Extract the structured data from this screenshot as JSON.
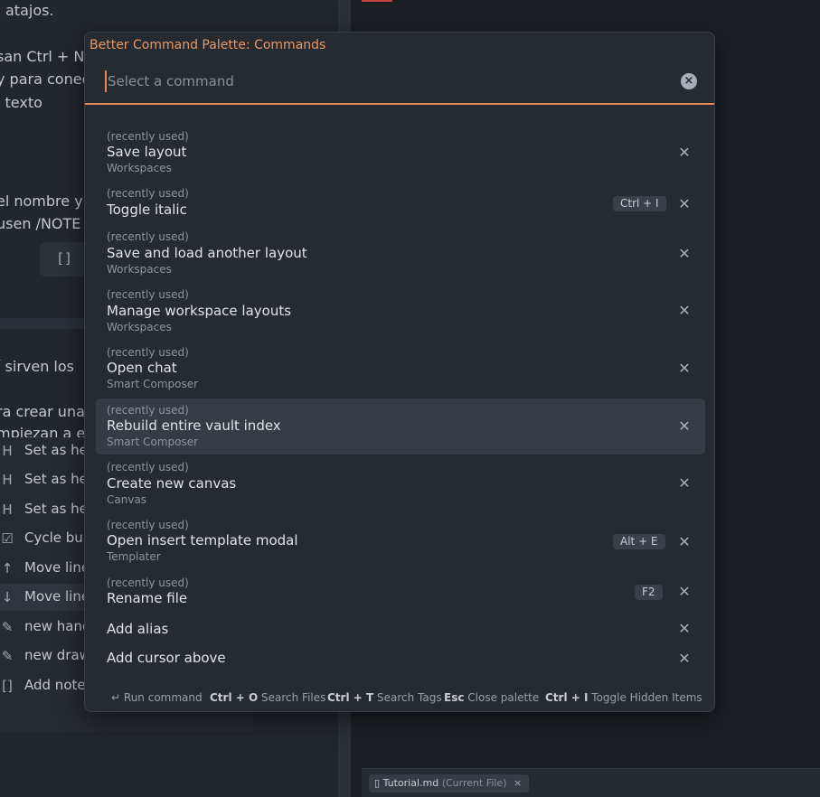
{
  "background": {
    "left_text": [
      "atajos.",
      "san Ctrl + N",
      "y para conec",
      "l texto",
      "el nombre y",
      "usen /NOTE",
      "í sirven los",
      "ra crear una",
      "mpiezan a es"
    ],
    "code_chip": "[]",
    "suggestions": [
      {
        "icon": "H",
        "label": "Set as he"
      },
      {
        "icon": "H",
        "label": "Set as he"
      },
      {
        "icon": "H",
        "label": "Set as he"
      },
      {
        "icon": "☑",
        "label": "Cycle bul"
      },
      {
        "icon": "↑",
        "label": "Move line"
      },
      {
        "icon": "↓",
        "label": "Move line"
      },
      {
        "icon": "✎",
        "label": "new hand"
      },
      {
        "icon": "✎",
        "label": "new draw"
      },
      {
        "icon": "[]",
        "label": "Add note"
      }
    ],
    "file_chip": {
      "name": "Tutorial.md",
      "suffix": "(Current File)",
      "close": "×"
    }
  },
  "palette": {
    "title": "Better Command Palette: Commands",
    "search_placeholder": "Select a command",
    "search_value": "",
    "clear_glyph": "×",
    "remove_glyph": "✕",
    "items": [
      {
        "note": "(recently used)",
        "name": "Save layout",
        "category": "Workspaces",
        "hotkey": ""
      },
      {
        "note": "(recently used)",
        "name": "Toggle italic",
        "category": "",
        "hotkey": "Ctrl + I"
      },
      {
        "note": "(recently used)",
        "name": "Save and load another layout",
        "category": "Workspaces",
        "hotkey": ""
      },
      {
        "note": "(recently used)",
        "name": "Manage workspace layouts",
        "category": "Workspaces",
        "hotkey": ""
      },
      {
        "note": "(recently used)",
        "name": "Open chat",
        "category": "Smart Composer",
        "hotkey": ""
      },
      {
        "note": "(recently used)",
        "name": "Rebuild entire vault index",
        "category": "Smart Composer",
        "hotkey": ""
      },
      {
        "note": "(recently used)",
        "name": "Create new canvas",
        "category": "Canvas",
        "hotkey": ""
      },
      {
        "note": "(recently used)",
        "name": "Open insert template modal",
        "category": "Templater",
        "hotkey": "Alt + E"
      },
      {
        "note": "(recently used)",
        "name": "Rename file",
        "category": "",
        "hotkey": "F2"
      },
      {
        "note": "",
        "name": "Add alias",
        "category": "",
        "hotkey": ""
      },
      {
        "note": "",
        "name": "Add cursor above",
        "category": "",
        "hotkey": ""
      }
    ],
    "footer": [
      {
        "key": "↵",
        "label": "Run command"
      },
      {
        "key": "Ctrl + O",
        "label": "Search Files"
      },
      {
        "key": "Ctrl + T",
        "label": "Search Tags"
      },
      {
        "key": "Esc",
        "label": "Close palette"
      },
      {
        "key": "Ctrl + I",
        "label": "Toggle Hidden Items"
      }
    ]
  },
  "colors": {
    "accent": "#e3875a",
    "title": "#e89868",
    "highlight": "#363c43"
  }
}
